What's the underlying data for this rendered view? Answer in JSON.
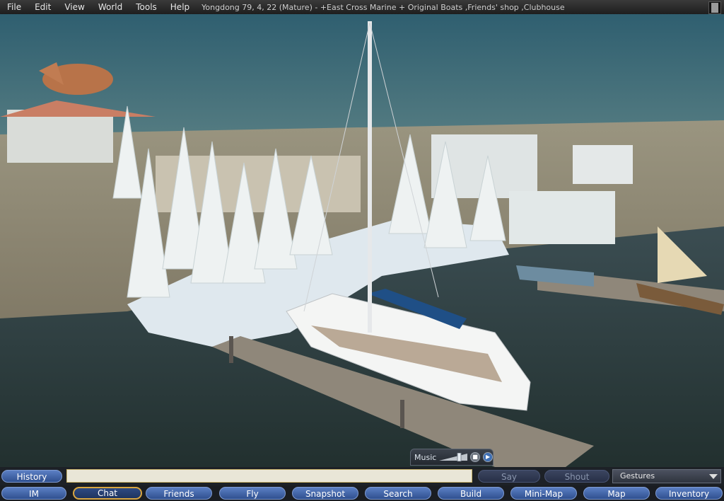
{
  "menu": {
    "items": [
      "File",
      "Edit",
      "View",
      "World",
      "Tools",
      "Help"
    ],
    "location": "Yongdong 79, 4, 22 (Mature) - +East Cross Marine + Original Boats ,Friends' shop ,Clubhouse"
  },
  "music": {
    "label": "Music",
    "volume": 0.75
  },
  "chat": {
    "history_label": "History",
    "input_value": "",
    "say_label": "Say",
    "shout_label": "Shout",
    "gestures_label": "Gestures"
  },
  "toolbar": {
    "buttons": [
      "IM",
      "Chat",
      "Friends",
      "Fly",
      "Snapshot",
      "Search",
      "Build",
      "Mini-Map",
      "Map",
      "Inventory"
    ],
    "active": "Chat"
  },
  "colors": {
    "sky_top": "#2f5f70",
    "sky_horizon": "#b8c8b0",
    "water": "#2c3c40",
    "button_blue": "#3f63a8",
    "active_border": "#d9a641"
  }
}
